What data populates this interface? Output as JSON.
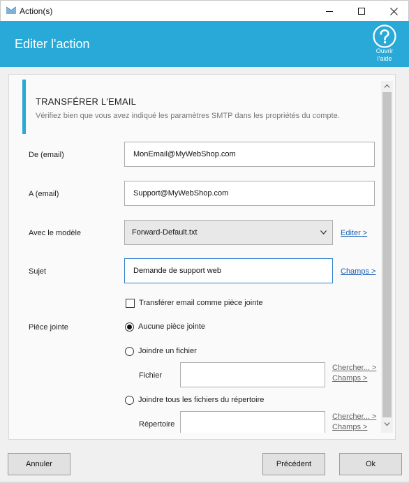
{
  "window": {
    "title": "Action(s)"
  },
  "header": {
    "title": "Editer l'action",
    "help_label_1": "Ouvrir",
    "help_label_2": "l'aide"
  },
  "section": {
    "title": "TRANSFÉRER L'EMAIL",
    "subtitle": "Vérifiez bien que vous avez indiqué les paramètres SMTP dans les propriétés du compte."
  },
  "form": {
    "from_label": "De (email)",
    "from_value": "MonEmail@MyWebShop.com",
    "to_label": "A (email)",
    "to_value": "Support@MyWebShop.com",
    "template_label": "Avec le modèle",
    "template_value": "Forward-Default.txt",
    "template_edit_link": "Editer >",
    "subject_label": "Sujet",
    "subject_value": "Demande de support web",
    "subject_fields_link": "Champs >",
    "forward_as_attachment_label": "Transférer email comme pièce jointe",
    "forward_as_attachment_checked": false,
    "attachment_label": "Pièce jointe",
    "attachment_options": [
      {
        "label": "Aucune pièce jointe",
        "selected": true
      },
      {
        "label": "Joindre un fichier",
        "selected": false
      },
      {
        "label": "Joindre tous les fichiers du répertoire",
        "selected": false
      }
    ],
    "file_label": "Fichier",
    "file_value": "",
    "file_browse_link": "Chercher... >",
    "file_fields_link": "Champs >",
    "directory_label": "Répertoire",
    "directory_value": "",
    "directory_browse_link": "Chercher... >",
    "directory_fields_link": "Champs >"
  },
  "footer": {
    "cancel_label": "Annuler",
    "previous_label": "Précédent",
    "ok_label": "Ok"
  },
  "colors": {
    "accent": "#29a9d8",
    "link": "#1a5fb4",
    "focus_border": "#2f7fd2"
  }
}
